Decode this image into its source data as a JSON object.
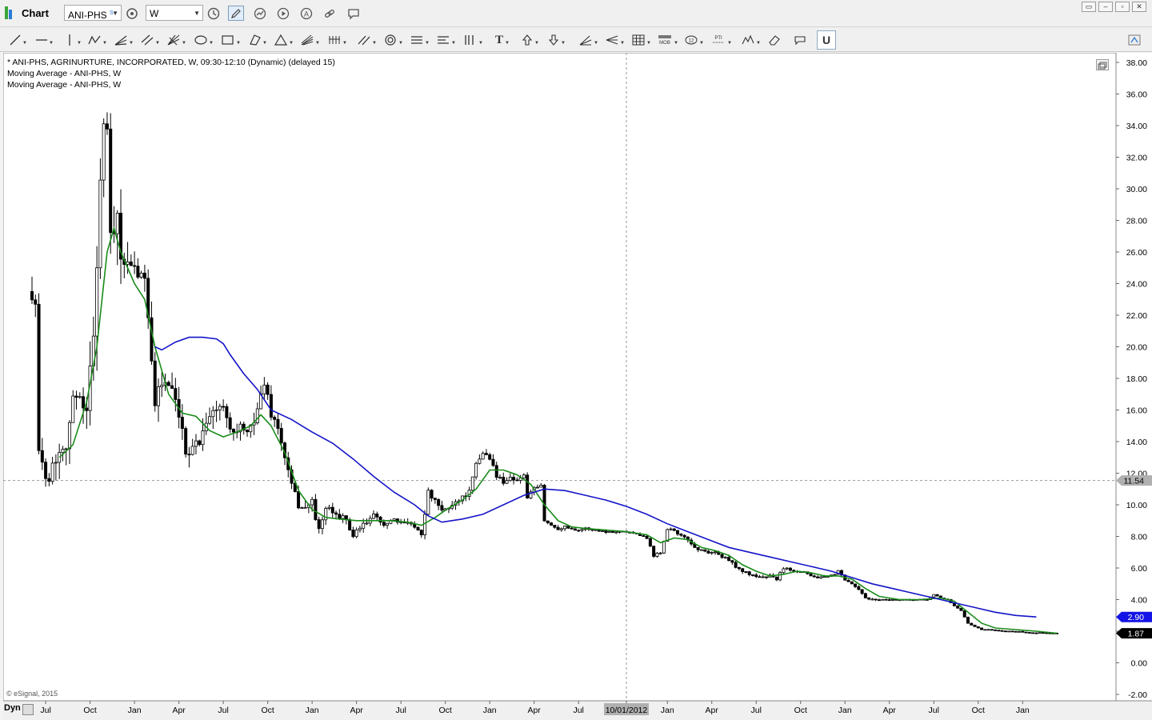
{
  "app": {
    "title": "Chart",
    "symbol": "ANI-PHS",
    "symbol_badge": "S",
    "interval": "W"
  },
  "legend": {
    "main": "* ANI-PHS, AGRINURTURE, INCORPORATED, W, 09:30-12:10 (Dynamic) (delayed 15)",
    "ma1": "Moving Average - ANI-PHS, W",
    "ma2": "Moving Average - ANI-PHS, W"
  },
  "footer": {
    "copyright": "© eSignal, 2015",
    "mode": "Dyn"
  },
  "colors": {
    "ma_fast": "#1a8c1a",
    "ma_slow": "#1414c8",
    "candle": "#000000",
    "price_tag_blue": "#1414e6",
    "price_tag_black": "#000000",
    "crosshair_tag": "#b0b0b0"
  },
  "chart_data": {
    "type": "candlestick",
    "title": "",
    "xlabel": "",
    "ylabel": "",
    "ylim": [
      -2,
      38.5
    ],
    "y_ticks": [
      "38.00",
      "36.00",
      "34.00",
      "32.00",
      "30.00",
      "28.00",
      "26.00",
      "24.00",
      "22.00",
      "20.00",
      "18.00",
      "16.00",
      "14.00",
      "12.00",
      "10.00",
      "8.00",
      "6.00",
      "4.00",
      "2.00",
      "0.00",
      "-2.00"
    ],
    "x_ticks": [
      {
        "label": "Jul",
        "week": 4
      },
      {
        "label": "Oct",
        "week": 17
      },
      {
        "label": "Jan",
        "week": 30
      },
      {
        "label": "Apr",
        "week": 43
      },
      {
        "label": "Jul",
        "week": 56
      },
      {
        "label": "Oct",
        "week": 69
      },
      {
        "label": "Jan",
        "week": 82
      },
      {
        "label": "Apr",
        "week": 95
      },
      {
        "label": "Jul",
        "week": 108
      },
      {
        "label": "Oct",
        "week": 121
      },
      {
        "label": "Jan",
        "week": 134
      },
      {
        "label": "Apr",
        "week": 147
      },
      {
        "label": "Jul",
        "week": 160
      },
      {
        "label": "10/01/2012",
        "week": 174
      },
      {
        "label": "Jan",
        "week": 186
      },
      {
        "label": "Apr",
        "week": 199
      },
      {
        "label": "Jul",
        "week": 212
      },
      {
        "label": "Oct",
        "week": 225
      },
      {
        "label": "Jan",
        "week": 238
      },
      {
        "label": "Apr",
        "week": 251
      },
      {
        "label": "Jul",
        "week": 264
      },
      {
        "label": "Oct",
        "week": 277
      },
      {
        "label": "Jan",
        "week": 290
      }
    ],
    "week_count": 301,
    "price_anchors": [
      [
        0,
        23.5
      ],
      [
        1,
        23.0
      ],
      [
        2,
        13.0
      ],
      [
        3,
        12.5
      ],
      [
        4,
        12.2
      ],
      [
        5,
        11.8
      ],
      [
        6,
        12.5
      ],
      [
        8,
        13.5
      ],
      [
        10,
        14.0
      ],
      [
        12,
        16.5
      ],
      [
        14,
        17.2
      ],
      [
        16,
        15.8
      ],
      [
        18,
        21.0
      ],
      [
        20,
        30.5
      ],
      [
        21,
        34.0
      ],
      [
        22,
        33.0
      ],
      [
        23,
        27.0
      ],
      [
        25,
        27.5
      ],
      [
        27,
        25.0
      ],
      [
        29,
        24.5
      ],
      [
        31,
        24.8
      ],
      [
        32,
        24.0
      ],
      [
        33,
        24.5
      ],
      [
        34,
        22.5
      ],
      [
        36,
        16.2
      ],
      [
        37,
        17.5
      ],
      [
        39,
        17.8
      ],
      [
        41,
        17.0
      ],
      [
        43,
        15.5
      ],
      [
        45,
        13.3
      ],
      [
        47,
        13.8
      ],
      [
        49,
        14.0
      ],
      [
        51,
        15.5
      ],
      [
        53,
        15.8
      ],
      [
        55,
        16.2
      ],
      [
        57,
        15.8
      ],
      [
        59,
        14.5
      ],
      [
        61,
        15.0
      ],
      [
        63,
        14.3
      ],
      [
        65,
        15.5
      ],
      [
        67,
        16.8
      ],
      [
        68,
        17.8
      ],
      [
        70,
        15.8
      ],
      [
        72,
        14.8
      ],
      [
        74,
        13.0
      ],
      [
        76,
        11.2
      ],
      [
        78,
        10.0
      ],
      [
        80,
        9.8
      ],
      [
        82,
        10.2
      ],
      [
        84,
        8.3
      ],
      [
        86,
        9.8
      ],
      [
        88,
        9.5
      ],
      [
        90,
        9.3
      ],
      [
        92,
        9.0
      ],
      [
        94,
        8.0
      ],
      [
        96,
        8.5
      ],
      [
        98,
        8.9
      ],
      [
        100,
        9.3
      ],
      [
        102,
        8.9
      ],
      [
        104,
        8.8
      ],
      [
        106,
        9.0
      ],
      [
        108,
        8.8
      ],
      [
        110,
        9.0
      ],
      [
        112,
        8.6
      ],
      [
        114,
        8.2
      ],
      [
        116,
        10.8
      ],
      [
        118,
        10.2
      ],
      [
        120,
        9.6
      ],
      [
        122,
        9.8
      ],
      [
        124,
        10.2
      ],
      [
        126,
        10.5
      ],
      [
        128,
        10.8
      ],
      [
        130,
        12.5
      ],
      [
        132,
        13.3
      ],
      [
        134,
        13.0
      ],
      [
        136,
        11.8
      ],
      [
        138,
        11.5
      ],
      [
        140,
        11.7
      ],
      [
        142,
        11.6
      ],
      [
        144,
        11.8
      ],
      [
        145,
        10.5
      ],
      [
        147,
        11.0
      ],
      [
        149,
        11.2
      ],
      [
        150,
        9.0
      ],
      [
        152,
        8.7
      ],
      [
        154,
        8.5
      ],
      [
        156,
        8.6
      ],
      [
        158,
        8.5
      ],
      [
        160,
        8.4
      ],
      [
        162,
        8.5
      ],
      [
        165,
        8.4
      ],
      [
        168,
        8.3
      ],
      [
        171,
        8.3
      ],
      [
        174,
        8.3
      ],
      [
        177,
        8.2
      ],
      [
        180,
        7.9
      ],
      [
        182,
        6.8
      ],
      [
        184,
        7.0
      ],
      [
        186,
        8.5
      ],
      [
        188,
        8.4
      ],
      [
        190,
        8.0
      ],
      [
        192,
        7.8
      ],
      [
        194,
        7.3
      ],
      [
        196,
        7.1
      ],
      [
        198,
        7.0
      ],
      [
        200,
        7.0
      ],
      [
        202,
        6.7
      ],
      [
        204,
        6.5
      ],
      [
        206,
        6.1
      ],
      [
        208,
        5.8
      ],
      [
        210,
        5.6
      ],
      [
        212,
        5.5
      ],
      [
        214,
        5.4
      ],
      [
        216,
        5.5
      ],
      [
        218,
        5.3
      ],
      [
        220,
        6.0
      ],
      [
        222,
        5.9
      ],
      [
        224,
        5.8
      ],
      [
        226,
        5.8
      ],
      [
        228,
        5.5
      ],
      [
        230,
        5.4
      ],
      [
        232,
        5.4
      ],
      [
        234,
        5.5
      ],
      [
        236,
        5.8
      ],
      [
        238,
        5.2
      ],
      [
        240,
        5.0
      ],
      [
        242,
        4.6
      ],
      [
        244,
        4.1
      ],
      [
        246,
        4.0
      ],
      [
        250,
        4.0
      ],
      [
        254,
        4.0
      ],
      [
        258,
        4.0
      ],
      [
        262,
        4.0
      ],
      [
        264,
        4.3
      ],
      [
        266,
        4.1
      ],
      [
        268,
        4.0
      ],
      [
        270,
        3.6
      ],
      [
        272,
        3.3
      ],
      [
        274,
        2.5
      ],
      [
        276,
        2.3
      ],
      [
        278,
        2.1
      ],
      [
        280,
        2.1
      ],
      [
        284,
        2.0
      ],
      [
        288,
        2.0
      ],
      [
        292,
        1.9
      ],
      [
        296,
        1.9
      ],
      [
        300,
        1.87
      ]
    ],
    "volatility_anchors": [
      [
        0,
        1.2
      ],
      [
        5,
        1.2
      ],
      [
        15,
        1.3
      ],
      [
        20,
        2.8
      ],
      [
        30,
        1.8
      ],
      [
        40,
        1.0
      ],
      [
        60,
        0.8
      ],
      [
        75,
        0.6
      ],
      [
        85,
        0.45
      ],
      [
        110,
        0.3
      ],
      [
        125,
        0.35
      ],
      [
        135,
        0.4
      ],
      [
        150,
        0.2
      ],
      [
        175,
        0.1
      ],
      [
        190,
        0.2
      ],
      [
        215,
        0.15
      ],
      [
        240,
        0.12
      ],
      [
        260,
        0.06
      ],
      [
        280,
        0.05
      ],
      [
        300,
        0.04
      ]
    ],
    "series": [
      {
        "name": "",
        "type": "moving_average",
        "color": "#1a8c1a",
        "points": [
          [
            8,
            13.0
          ],
          [
            12,
            13.8
          ],
          [
            16,
            16.5
          ],
          [
            19,
            20.0
          ],
          [
            22,
            26.0
          ],
          [
            24,
            27.5
          ],
          [
            26,
            26.0
          ],
          [
            30,
            24.0
          ],
          [
            33,
            23.0
          ],
          [
            36,
            20.0
          ],
          [
            40,
            17.0
          ],
          [
            44,
            15.8
          ],
          [
            48,
            15.6
          ],
          [
            52,
            14.7
          ],
          [
            56,
            14.3
          ],
          [
            60,
            14.6
          ],
          [
            64,
            15.0
          ],
          [
            67,
            15.7
          ],
          [
            70,
            15.0
          ],
          [
            74,
            13.3
          ],
          [
            78,
            10.9
          ],
          [
            82,
            9.7
          ],
          [
            86,
            9.2
          ],
          [
            90,
            9.1
          ],
          [
            95,
            9.0
          ],
          [
            100,
            9.0
          ],
          [
            105,
            9.0
          ],
          [
            110,
            8.9
          ],
          [
            114,
            8.7
          ],
          [
            118,
            9.2
          ],
          [
            122,
            9.8
          ],
          [
            126,
            10.3
          ],
          [
            130,
            11.0
          ],
          [
            134,
            12.2
          ],
          [
            138,
            12.2
          ],
          [
            142,
            11.9
          ],
          [
            146,
            11.3
          ],
          [
            150,
            10.0
          ],
          [
            154,
            9.0
          ],
          [
            158,
            8.6
          ],
          [
            162,
            8.5
          ],
          [
            168,
            8.4
          ],
          [
            174,
            8.3
          ],
          [
            180,
            8.1
          ],
          [
            184,
            7.6
          ],
          [
            188,
            7.9
          ],
          [
            192,
            7.8
          ],
          [
            196,
            7.3
          ],
          [
            200,
            7.1
          ],
          [
            204,
            6.8
          ],
          [
            208,
            6.2
          ],
          [
            212,
            5.8
          ],
          [
            216,
            5.5
          ],
          [
            220,
            5.6
          ],
          [
            224,
            5.8
          ],
          [
            228,
            5.7
          ],
          [
            232,
            5.5
          ],
          [
            236,
            5.5
          ],
          [
            240,
            5.3
          ],
          [
            244,
            4.7
          ],
          [
            248,
            4.2
          ],
          [
            254,
            4.0
          ],
          [
            260,
            4.0
          ],
          [
            266,
            4.1
          ],
          [
            270,
            3.9
          ],
          [
            274,
            3.2
          ],
          [
            278,
            2.5
          ],
          [
            282,
            2.2
          ],
          [
            288,
            2.1
          ],
          [
            294,
            2.0
          ],
          [
            300,
            1.87
          ]
        ]
      },
      {
        "name": "",
        "type": "moving_average",
        "color": "#1414c8",
        "points": [
          [
            36,
            20.0
          ],
          [
            38,
            19.8
          ],
          [
            42,
            20.3
          ],
          [
            46,
            20.6
          ],
          [
            50,
            20.6
          ],
          [
            54,
            20.5
          ],
          [
            56,
            20.2
          ],
          [
            58,
            19.5
          ],
          [
            62,
            18.3
          ],
          [
            66,
            17.3
          ],
          [
            70,
            16.0
          ],
          [
            76,
            15.4
          ],
          [
            82,
            14.6
          ],
          [
            88,
            13.9
          ],
          [
            94,
            12.9
          ],
          [
            100,
            11.8
          ],
          [
            106,
            10.8
          ],
          [
            112,
            10.0
          ],
          [
            116,
            9.3
          ],
          [
            120,
            8.9
          ],
          [
            126,
            9.1
          ],
          [
            132,
            9.4
          ],
          [
            138,
            10.0
          ],
          [
            144,
            10.6
          ],
          [
            150,
            11.0
          ],
          [
            156,
            10.9
          ],
          [
            162,
            10.6
          ],
          [
            168,
            10.3
          ],
          [
            174,
            9.9
          ],
          [
            180,
            9.4
          ],
          [
            186,
            8.8
          ],
          [
            192,
            8.3
          ],
          [
            198,
            7.8
          ],
          [
            204,
            7.3
          ],
          [
            210,
            7.0
          ],
          [
            216,
            6.7
          ],
          [
            222,
            6.4
          ],
          [
            228,
            6.1
          ],
          [
            234,
            5.8
          ],
          [
            240,
            5.4
          ],
          [
            246,
            5.0
          ],
          [
            252,
            4.7
          ],
          [
            258,
            4.4
          ],
          [
            264,
            4.1
          ],
          [
            270,
            3.8
          ],
          [
            276,
            3.5
          ],
          [
            282,
            3.2
          ],
          [
            288,
            3.0
          ],
          [
            294,
            2.9
          ]
        ]
      }
    ],
    "last_values": {
      "ma_slow": "2.90",
      "ma_fast": "1.87"
    },
    "crosshair": {
      "price": "11.54",
      "date_week": 174
    }
  }
}
